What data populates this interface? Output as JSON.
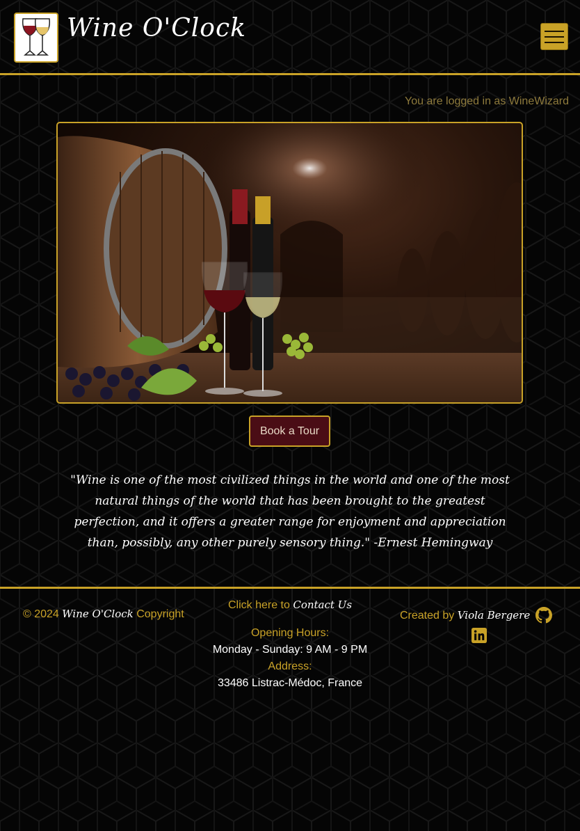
{
  "header": {
    "brand": "Wine O'Clock",
    "logo_icon": "wine-glasses-icon",
    "menu_icon": "hamburger-menu-icon"
  },
  "login_status": "You are logged in as WineWizard",
  "hero": {
    "image": "wine-cellar-barrel-bottles-glasses-grapes"
  },
  "book_tour_label": "Book a Tour",
  "quote": "\"Wine is one of the most civilized things in the world and one of the most natural things of the world that has been brought to the greatest perfection, and it offers a greater range for enjoyment and appreciation than, possibly, any other purely sensory thing.\" -Ernest Hemingway",
  "footer": {
    "copyright_prefix": "© 2024",
    "copyright_brand": "Wine O'Clock",
    "copyright_suffix": "Copyright",
    "contact_prefix": "Click here to",
    "contact_link": "Contact Us",
    "hours_label": "Opening Hours:",
    "hours_value": "Monday - Sunday: 9 AM - 9 PM",
    "address_label": "Address:",
    "address_value": "33486 Listrac-Médoc, France",
    "created_by_prefix": "Created by",
    "created_by_name": "Viola Bergere",
    "github_icon": "github-icon",
    "linkedin_icon": "linkedin-icon"
  },
  "colors": {
    "accent_gold": "#c9a227",
    "button_wine": "#4a0d15",
    "background": "#050505"
  }
}
